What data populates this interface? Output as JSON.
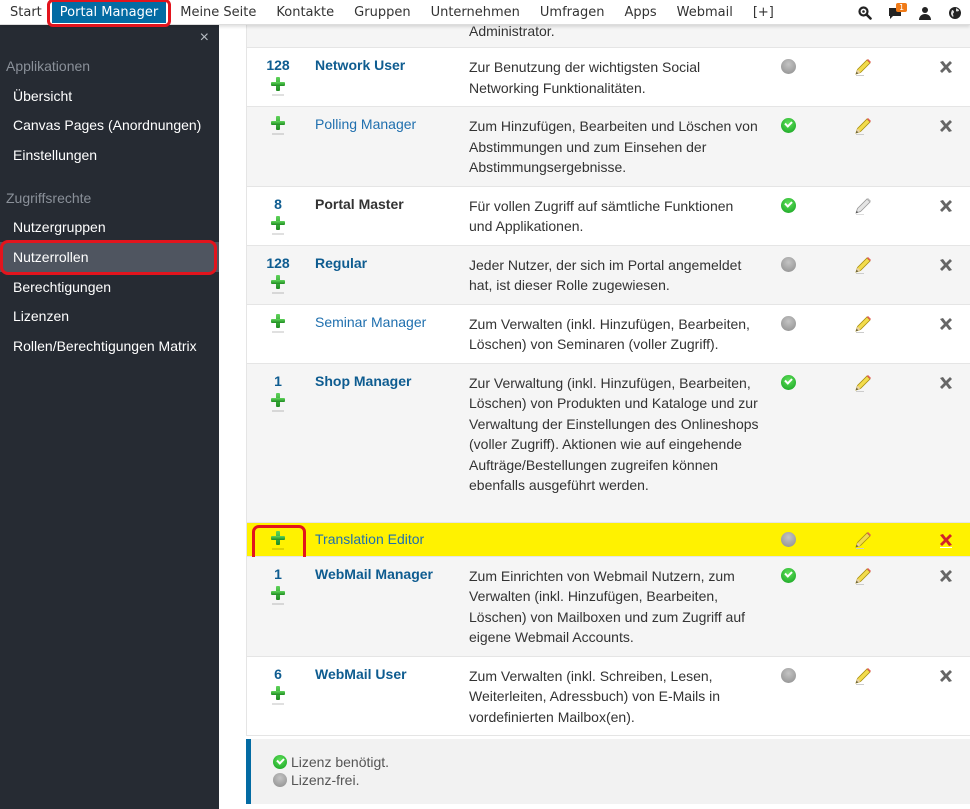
{
  "topnav": {
    "items": [
      "Start",
      "Portal Manager",
      "Meine Seite",
      "Kontakte",
      "Gruppen",
      "Unternehmen",
      "Umfragen",
      "Apps",
      "Webmail",
      "[+]"
    ],
    "active": "Portal Manager",
    "notification_count": "1"
  },
  "sidebar": {
    "close_label": "×",
    "sections": [
      {
        "title": "Applikationen",
        "items": [
          "Übersicht",
          "Canvas Pages (Anordnungen)",
          "Einstellungen"
        ]
      },
      {
        "title": "Zugriffsrechte",
        "items": [
          "Nutzergruppen",
          "Nutzerrollen",
          "Berechtigungen",
          "Lizenzen",
          "Rollen/Berechtigungen Matrix"
        ]
      }
    ],
    "active_item": "Nutzerrollen"
  },
  "table": {
    "partial_top_text": "Administrator.",
    "rows": [
      {
        "count": "128",
        "name": "Network User",
        "style": "bold",
        "description": "Zur Benutzung der wichtigsten Social Networking Funktionalitäten.",
        "license": "free",
        "editable": true
      },
      {
        "count": "",
        "name": "Polling Manager",
        "style": "link",
        "description": "Zum Hinzufügen, Bearbeiten und Löschen von Abstimmungen und zum Einsehen der Abstimmungsergebnisse.",
        "license": "required",
        "editable": true
      },
      {
        "count": "8",
        "name": "Portal Master",
        "style": "bold-dark",
        "description": "Für vollen Zugriff auf sämtliche Funktionen und Applikationen.",
        "license": "required",
        "editable": false
      },
      {
        "count": "128",
        "name": "Regular",
        "style": "bold",
        "description": "Jeder Nutzer, der sich im Portal angemeldet hat, ist dieser Rolle zugewiesen.",
        "license": "free",
        "editable": true
      },
      {
        "count": "",
        "name": "Seminar Manager",
        "style": "link",
        "description": "Zum Verwalten (inkl. Hinzufügen, Bearbeiten, Löschen) von Seminaren (voller Zugriff).",
        "license": "free",
        "editable": true
      },
      {
        "count": "1",
        "name": "Shop Manager",
        "style": "bold",
        "description": "Zur Verwaltung (inkl. Hinzufügen, Bearbeiten, Löschen) von Produkten und Kataloge und zur Verwaltung der Einstellungen des Onlineshops (voller Zugriff). Aktionen wie auf eingehende Aufträge/Bestellungen zugreifen können ebenfalls ausgeführt werden.",
        "license": "required",
        "editable": true
      },
      {
        "count": "",
        "name": "Translation Editor",
        "style": "link",
        "description": "",
        "license": "free",
        "editable": true,
        "highlighted": true
      },
      {
        "count": "1",
        "name": "WebMail Manager",
        "style": "bold",
        "description": "Zum Einrichten von Webmail Nutzern, zum Verwalten (inkl. Hinzufügen, Bearbeiten, Löschen) von Mailboxen und zum Zugriff auf eigene Webmail Accounts.",
        "license": "required",
        "editable": true
      },
      {
        "count": "6",
        "name": "WebMail User",
        "style": "bold",
        "description": "Zum Verwalten (inkl. Schreiben, Lesen, Weiterleiten, Adressbuch) von E-Mails in vordefinierten Mailbox(en).",
        "license": "free",
        "editable": true
      }
    ]
  },
  "legend": {
    "required": "Lizenz benötigt.",
    "free": "Lizenz-frei."
  },
  "colors": {
    "accent": "#036ba3",
    "highlight": "#fff200",
    "annotation": "#e2141d",
    "sidebar_bg": "#262b33"
  }
}
